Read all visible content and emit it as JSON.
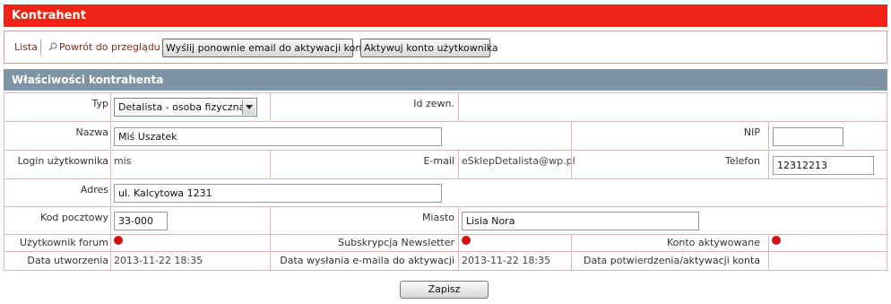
{
  "header": {
    "title": "Kontrahent"
  },
  "toolbar": {
    "list_link": "Lista",
    "back_link": "Powrót do przeglądu",
    "resend_button": "Wyślij ponownie email do aktywacji konta",
    "activate_button": "Aktywuj konto użytkownika"
  },
  "section": {
    "title": "Właściwości kontrahenta"
  },
  "form": {
    "type": {
      "label": "Typ",
      "value": "Detalista - osoba fizyczna"
    },
    "external_id": {
      "label": "Id zewn.",
      "value": ""
    },
    "name": {
      "label": "Nazwa",
      "value": "Miś Uszatek"
    },
    "nip": {
      "label": "NIP",
      "value": ""
    },
    "login": {
      "label": "Login użytkownika",
      "value": "mis"
    },
    "email": {
      "label": "E-mail",
      "value": "eSklepDetalista@wp.pl"
    },
    "phone": {
      "label": "Telefon",
      "value": "12312213"
    },
    "address": {
      "label": "Adres",
      "value": "ul. Kalcytowa 1231"
    },
    "postal_code": {
      "label": "Kod pocztowy",
      "value": "33-000"
    },
    "city": {
      "label": "Miasto",
      "value": "Lisia Nora"
    },
    "forum_user": {
      "label": "Użytkownik forum",
      "status_color": "#d21212"
    },
    "newsletter": {
      "label": "Subskrypcja Newsletter",
      "status_color": "#d21212"
    },
    "account_active": {
      "label": "Konto aktywowane",
      "status_color": "#d21212"
    },
    "created": {
      "label": "Data utworzenia",
      "value": "2013-11-22 18:35"
    },
    "activation_email_sent": {
      "label": "Data wysłania e-maila do aktywacji",
      "value": "2013-11-22 18:35"
    },
    "activation_confirmed": {
      "label": "Data potwierdzenia/aktywacji konta",
      "value": ""
    }
  },
  "actions": {
    "save_label": "Zapisz"
  }
}
